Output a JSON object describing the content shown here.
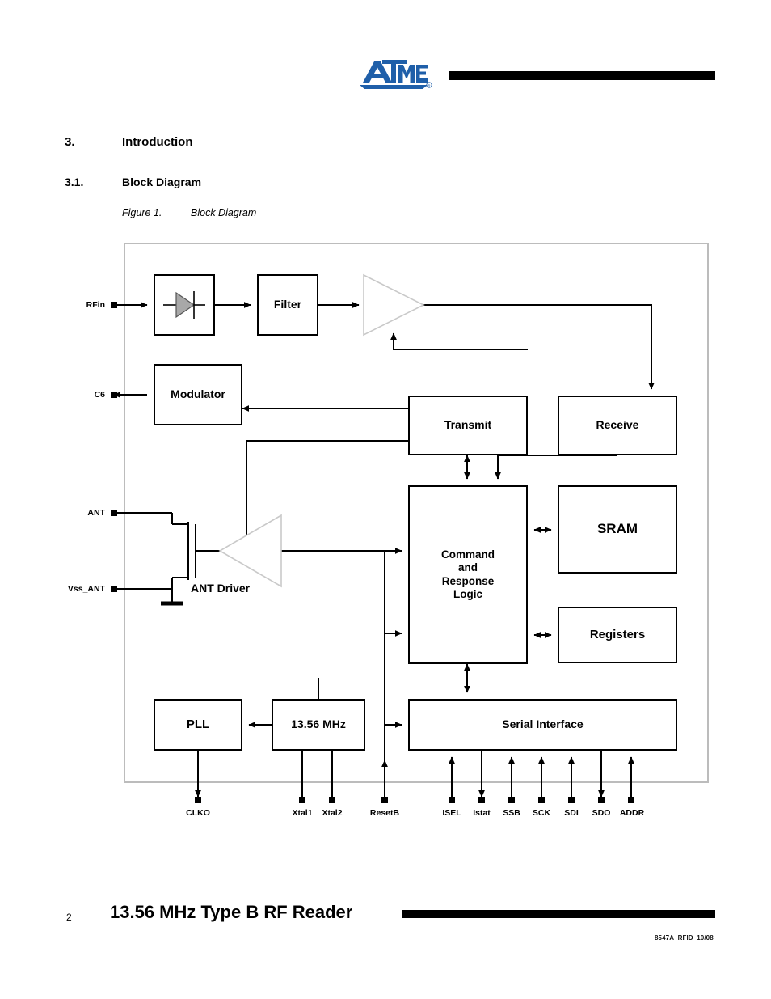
{
  "header": {
    "logo_alt": "ATMEL",
    "logo_color": "#1f5fa9"
  },
  "sections": {
    "intro_number": "3.",
    "intro_title": "Introduction",
    "block_diagram_number": "3.1.",
    "block_diagram_title": "Block Diagram",
    "figure_label": "Figure 1.",
    "figure_caption": "Block Diagram"
  },
  "diagram": {
    "blocks": [
      {
        "id": "diode",
        "label": "",
        "icon": "diode-icon"
      },
      {
        "id": "filter",
        "label": "Filter"
      },
      {
        "id": "modulator",
        "label": "Modulator"
      },
      {
        "id": "transmit",
        "label": "Transmit"
      },
      {
        "id": "receive",
        "label": "Receive"
      },
      {
        "id": "cmdlogic",
        "label": "Command\nand\nResponse\nLogic"
      },
      {
        "id": "sram",
        "label": "SRAM"
      },
      {
        "id": "registers",
        "label": "Registers"
      },
      {
        "id": "pll",
        "label": "PLL"
      },
      {
        "id": "xtal",
        "label": "13.56 MHz"
      },
      {
        "id": "serial",
        "label": "Serial Interface"
      }
    ],
    "amp_label": "ANT Driver",
    "left_pins": [
      {
        "name": "RFin",
        "label": "RFin",
        "direction": "in"
      },
      {
        "name": "C6",
        "label": "C6",
        "direction": "out"
      },
      {
        "name": "ANT",
        "label": "ANT",
        "direction": "out"
      },
      {
        "name": "Vss_ANT",
        "label": "Vss_ANT",
        "direction": "out"
      }
    ],
    "bottom_pins": [
      {
        "name": "CLKO",
        "label": "CLKO",
        "direction": "out"
      },
      {
        "name": "Xtal1",
        "label": "Xtal1",
        "direction": "out"
      },
      {
        "name": "Xtal2",
        "label": "Xtal2",
        "direction": "out"
      },
      {
        "name": "ResetB",
        "label": "ResetB",
        "direction": "in"
      },
      {
        "name": "ISEL",
        "label": "ISEL",
        "direction": "in"
      },
      {
        "name": "Istat",
        "label": "Istat",
        "direction": "out"
      },
      {
        "name": "SSB",
        "label": "SSB",
        "direction": "in"
      },
      {
        "name": "SCK",
        "label": "SCK",
        "direction": "in"
      },
      {
        "name": "SDI",
        "label": "SDI",
        "direction": "in"
      },
      {
        "name": "SDO",
        "label": "SDO",
        "direction": "out"
      },
      {
        "name": "ADDR",
        "label": "ADDR",
        "direction": "in"
      }
    ],
    "border_color": "#bcbcbc",
    "line_color": "#000000",
    "diode_fill": "#a8a8a8",
    "amp_outline": "#c9c9c9"
  },
  "footer": {
    "page_number": "2",
    "title": "13.56 MHz Type B RF Reader",
    "doc_code": "8547A–RFID–10/08"
  }
}
